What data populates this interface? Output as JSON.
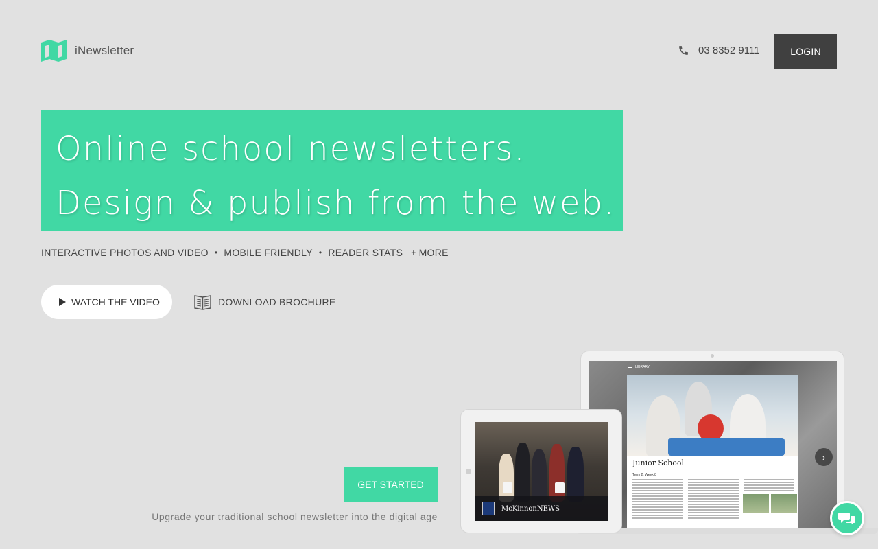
{
  "colors": {
    "accent": "#41d8a4",
    "background": "#e1e1e1",
    "login_bg": "#404040"
  },
  "header": {
    "logo_icon": "map-icon",
    "brand": "iNewsletter",
    "phone_icon": "phone-icon",
    "phone": "03 8352 9111",
    "login_label": "LOGIN"
  },
  "hero": {
    "line1": "Online school newsletters.",
    "line2": "Design & publish from the web."
  },
  "features": {
    "items": [
      "INTERACTIVE PHOTOS AND VIDEO",
      "MOBILE FRIENDLY",
      "READER STATS"
    ],
    "separator": "•",
    "more_prefix": "+",
    "more_label": "MORE"
  },
  "cta": {
    "watch_label": "WATCH THE VIDEO",
    "watch_icon": "play-icon",
    "brochure_label": "DOWNLOAD BROCHURE",
    "brochure_icon": "book-icon",
    "get_started_label": "GET STARTED",
    "tagline": "Upgrade your traditional school newsletter into the digital age"
  },
  "laptop_preview": {
    "library_label": "LIBRARY",
    "heading": "Junior School",
    "subheading": "Term 2, Week 8",
    "next_icon": "chevron-right-icon"
  },
  "tablet_preview": {
    "caption": "McKinnonNEWS"
  },
  "chat": {
    "icon": "chat-bubbles-icon"
  }
}
